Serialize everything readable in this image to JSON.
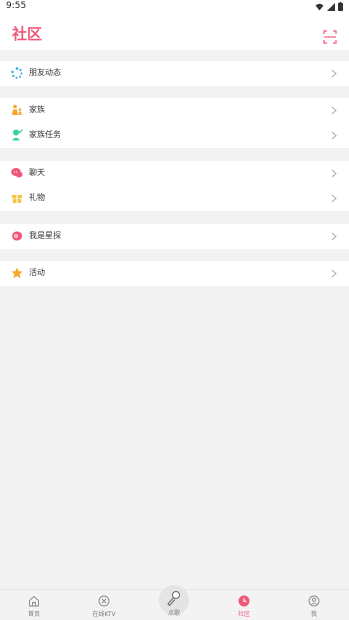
{
  "status_bar": {
    "time": "9:55"
  },
  "header": {
    "title": "社区"
  },
  "groups": [
    {
      "items": [
        {
          "label": "朋友动态",
          "icon": "friends-feed-icon",
          "color": "#29a8e0"
        }
      ]
    },
    {
      "items": [
        {
          "label": "家族",
          "icon": "family-icon",
          "color": "#f5a623"
        },
        {
          "label": "家族任务",
          "icon": "family-task-icon",
          "color": "#3ccfa6"
        }
      ]
    },
    {
      "items": [
        {
          "label": "聊天",
          "icon": "chat-icon",
          "color": "#f0587a"
        },
        {
          "label": "礼物",
          "icon": "gift-icon",
          "color": "#f5c542"
        }
      ]
    },
    {
      "items": [
        {
          "label": "我是星探",
          "icon": "star-scout-icon",
          "color": "#f0587a"
        }
      ]
    },
    {
      "items": [
        {
          "label": "活动",
          "icon": "activity-star-icon",
          "color": "#f5a623"
        }
      ]
    }
  ],
  "tabs": [
    {
      "label": "首页",
      "icon": "home-icon"
    },
    {
      "label": "在线KTV",
      "icon": "ktv-icon"
    },
    {
      "label": "点歌",
      "icon": "microphone-icon"
    },
    {
      "label": "社区",
      "icon": "community-icon",
      "active": true
    },
    {
      "label": "我",
      "icon": "profile-icon"
    }
  ],
  "colors": {
    "accent": "#f0587a",
    "background": "#f2f2f2"
  }
}
